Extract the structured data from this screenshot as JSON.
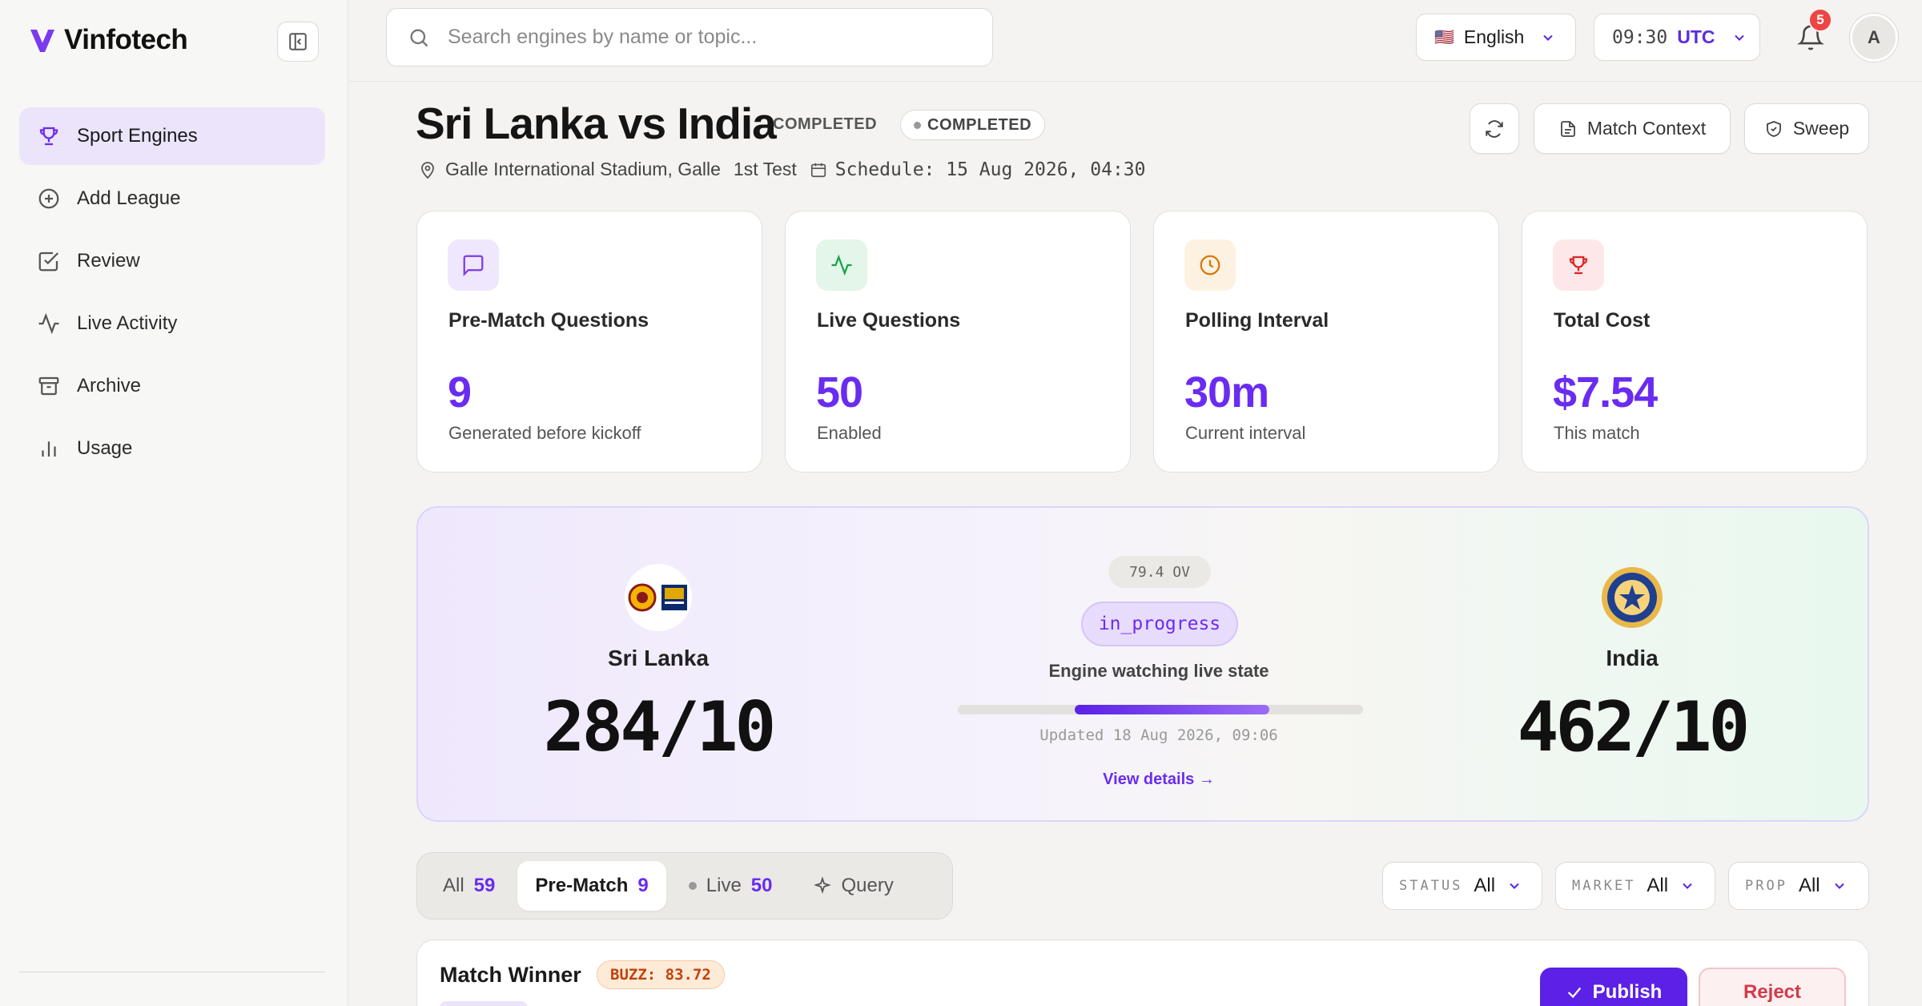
{
  "brand": {
    "name": "Vinfotech"
  },
  "sidebar": {
    "items": [
      {
        "label": "Sport Engines",
        "icon": "trophy-icon",
        "active": true
      },
      {
        "label": "Add League",
        "icon": "plus-circle-icon"
      },
      {
        "label": "Review",
        "icon": "check-square-icon"
      },
      {
        "label": "Live Activity",
        "icon": "activity-icon"
      },
      {
        "label": "Archive",
        "icon": "archive-icon"
      },
      {
        "label": "Usage",
        "icon": "bar-chart-icon"
      }
    ]
  },
  "topbar": {
    "search_placeholder": "Search engines by name or topic...",
    "language": "English",
    "language_flag": "🇺🇸",
    "time": "09:30",
    "timezone": "UTC",
    "notification_count": "5",
    "avatar_initial": "A"
  },
  "match": {
    "title": "Sri Lanka vs India",
    "status_label": "COMPLETED",
    "status_pill": "COMPLETED",
    "venue": "Galle International Stadium, Galle",
    "match_type": "1st Test",
    "schedule": "Schedule: 15 Aug 2026, 04:30",
    "actions": {
      "context": "Match Context",
      "sweep": "Sweep"
    }
  },
  "stats": [
    {
      "label": "Pre-Match Questions",
      "value": "9",
      "sub": "Generated before kickoff",
      "icon": "message-square-icon",
      "color": "#7c3aed"
    },
    {
      "label": "Live Questions",
      "value": "50",
      "sub": "Enabled",
      "icon": "activity-icon",
      "color": "#16a34a"
    },
    {
      "label": "Polling Interval",
      "value": "30m",
      "sub": "Current interval",
      "icon": "clock-icon",
      "color": "#d97706"
    },
    {
      "label": "Total Cost",
      "value": "$7.54",
      "sub": "This match",
      "icon": "trophy-icon",
      "color": "#dc2626"
    }
  ],
  "scoreboard": {
    "home": {
      "name": "Sri Lanka",
      "score": "284/10"
    },
    "away": {
      "name": "India",
      "score": "462/10"
    },
    "overs": "79.4 OV",
    "state": "in_progress",
    "state_text": "Engine watching live state",
    "progress": 0.48,
    "updated": "Updated 18 Aug 2026, 09:06",
    "details_link": "View details →"
  },
  "tabs": [
    {
      "label": "All",
      "count": "59"
    },
    {
      "label": "Pre-Match",
      "count": "9",
      "active": true
    },
    {
      "label": "Live",
      "count": "50"
    },
    {
      "label": "Query",
      "count": ""
    }
  ],
  "filters": [
    {
      "label": "STATUS",
      "value": "All"
    },
    {
      "label": "MARKET",
      "value": "All"
    },
    {
      "label": "PROP",
      "value": "All"
    }
  ],
  "question": {
    "title": "Match Winner",
    "buzz": "BUZZ: 83.72",
    "publish": "Publish",
    "reject": "Reject"
  }
}
